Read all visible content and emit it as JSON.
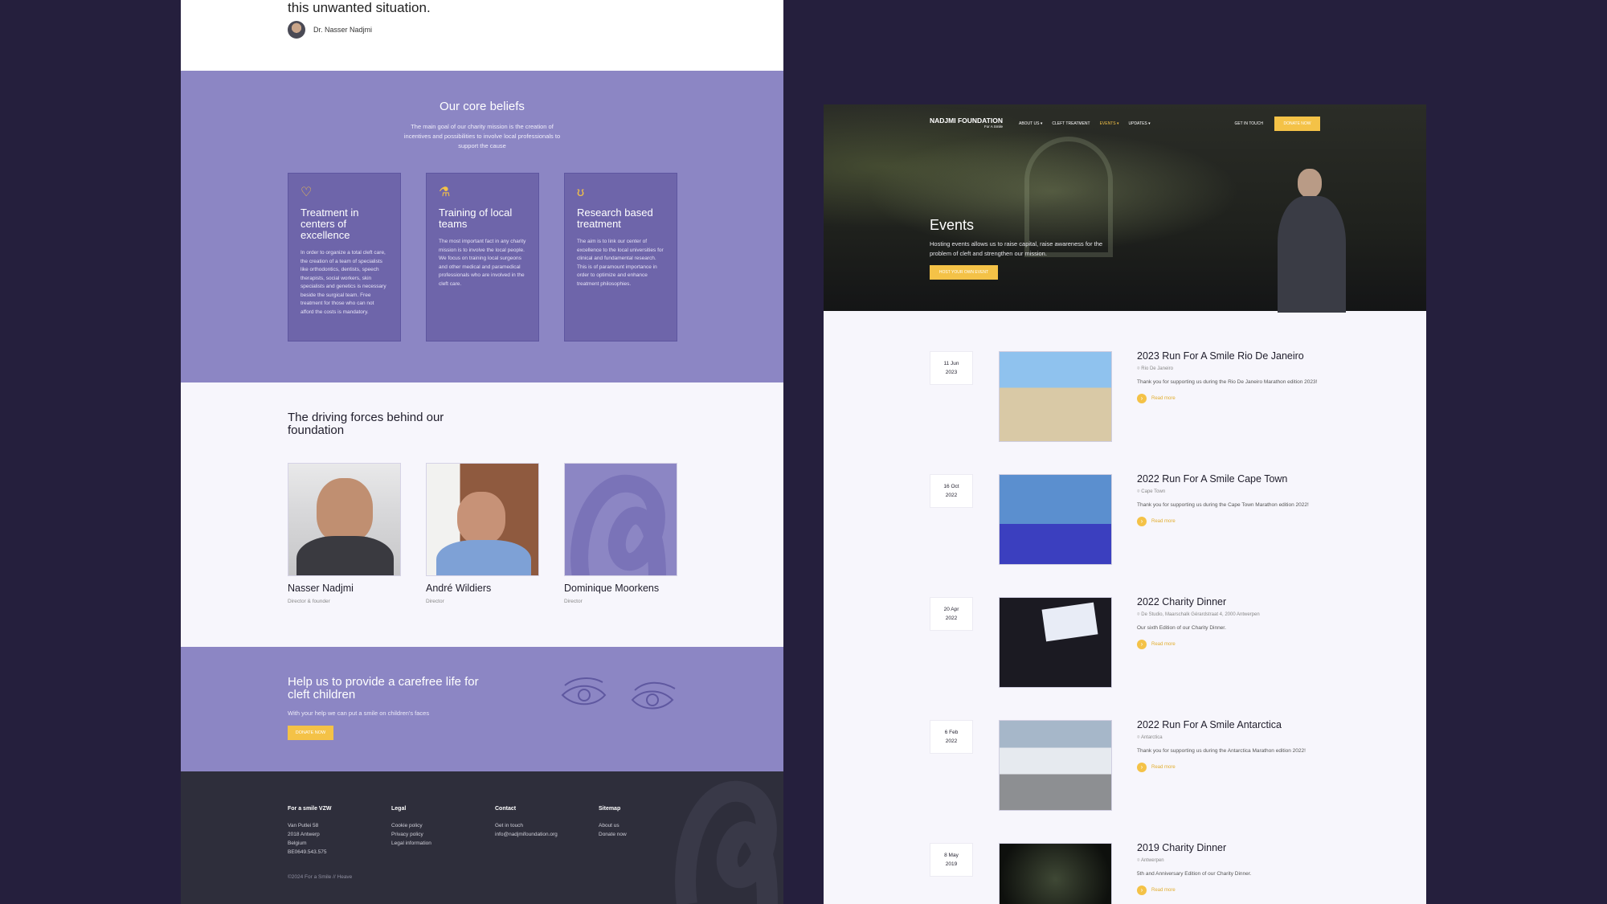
{
  "left_page": {
    "quote_tail": "this unwanted situation.",
    "author": "Dr. Nasser Nadjmi",
    "beliefs": {
      "title": "Our core beliefs",
      "subtitle": "The main goal of our charity mission is the creation of incentives and possibilities to involve local professionals to support the cause",
      "cards": [
        {
          "icon": "heart-hands-icon",
          "title": "Treatment in centers of excellence",
          "text": "In order to organize a total cleft care, the creation of a team of specialists like orthodontics, dentists, speech therapists, social workers, skin specialists and genetics is necessary beside the surgical team. Free treatment for those who can not afford the costs is mandatory."
        },
        {
          "icon": "microscope-icon",
          "title": "Training of local teams",
          "text": "The most important fact in any charity mission is to involve the local people. We focus on training local surgeons and other medical and paramedical professionals who are involved in the cleft care."
        },
        {
          "icon": "stethoscope-icon",
          "title": "Research based treatment",
          "text": "The aim is to link our center of excellence to the local universities for clinical and fundamental research. This is of paramount importance in order to optimize and enhance treatment philosophies."
        }
      ]
    },
    "forces": {
      "title": "The driving forces behind our foundation",
      "people": [
        {
          "name": "Nasser Nadjmi",
          "role": "Director & founder"
        },
        {
          "name": "André Wildiers",
          "role": "Director"
        },
        {
          "name": "Dominique Moorkens",
          "role": "Director"
        }
      ]
    },
    "help": {
      "title": "Help us to provide a carefree life for cleft children",
      "subtitle": "With your help we can put a smile on children's faces",
      "button": "DONATE NOW"
    },
    "footer": {
      "columns": [
        {
          "heading": "For a smile VZW",
          "lines": [
            "Van Putlei 58",
            "2018 Antwerp",
            "Belgium",
            "BE0649.543.575"
          ]
        },
        {
          "heading": "Legal",
          "lines": [
            "Cookie policy",
            "Privacy policy",
            "Legal information"
          ]
        },
        {
          "heading": "Contact",
          "lines": [
            "Get in touch",
            "info@nadjmifoundation.org"
          ]
        },
        {
          "heading": "Sitemap",
          "lines": [
            "About us",
            "Donate now"
          ]
        }
      ],
      "copyright": "©2024 For a Smile // Heave"
    }
  },
  "right_page": {
    "nav": {
      "logo": "NADJMI FOUNDATION",
      "logo_sub": "For A Smile",
      "menu": [
        "ABOUT US ▾",
        "CLEFT TREATMENT",
        "EVENTS ▾",
        "UPDATES ▾"
      ],
      "active_index": 2,
      "get_in_touch": "GET IN TOUCH",
      "donate": "DONATE NOW"
    },
    "hero": {
      "title": "Events",
      "description": "Hosting events allows us to raise capital, raise awareness for the problem of cleft and strengthen our mission.",
      "button": "HOST YOUR OWN EVENT"
    },
    "events": [
      {
        "day": "11 Jun",
        "year": "2023",
        "title": "2023 Run For A Smile Rio De Janeiro",
        "location": "Rio De Janeiro",
        "text": "Thank you for supporting us during the Rio De Janeiro Marathon edition 2023!",
        "more": "Read more"
      },
      {
        "day": "16 Oct",
        "year": "2022",
        "title": "2022 Run For A Smile Cape Town",
        "location": "Cape Town",
        "text": "Thank you for supporting us during the Cape Town Marathon edition 2022!",
        "more": "Read more"
      },
      {
        "day": "20 Apr",
        "year": "2022",
        "title": "2022 Charity Dinner",
        "location": "De Studio, Maarschalk Gérardstraat 4, 2000 Antwerpen",
        "text": "Our sixth Edition of our Charity Dinner.",
        "more": "Read more"
      },
      {
        "day": "6 Feb",
        "year": "2022",
        "title": "2022 Run For A Smile Antarctica",
        "location": "Antarctica",
        "text": "Thank you for supporting us during the Antarctica Marathon edition 2022!",
        "more": "Read more"
      },
      {
        "day": "8 May",
        "year": "2019",
        "title": "2019 Charity Dinner",
        "location": "Antwerpen",
        "text": "5th and Anniversary Edition of our Charity Dinner.",
        "more": "Read more"
      }
    ]
  },
  "colors": {
    "background": "#251f3d",
    "purple": "#8c86c4",
    "card_purple": "#6e65aa",
    "accent": "#f4c247",
    "footer": "#2e2e3b"
  }
}
